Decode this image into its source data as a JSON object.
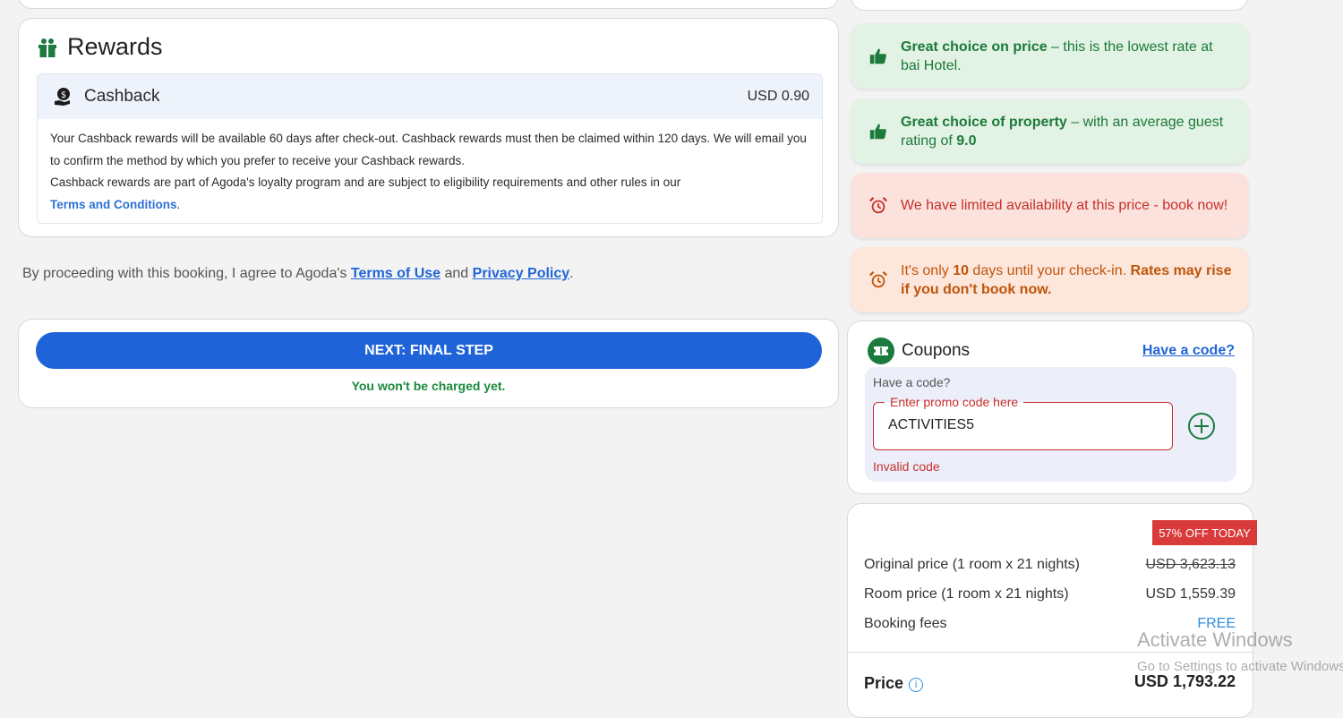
{
  "rewards": {
    "title": "Rewards",
    "cashback_label": "Cashback",
    "cashback_amount": "USD 0.90",
    "text_1": "Your Cashback rewards will be available 60 days after check-out. Cashback rewards must then be claimed within 120 days. We will email you to confirm the method by which you prefer to receive your Cashback rewards.",
    "text_2": "Cashback rewards are part of Agoda's loyalty program and are subject to eligibility requirements and other rules in our",
    "terms_link": "Terms and Conditions",
    "terms_suffix": "."
  },
  "agreement": {
    "prefix": "By proceeding with this booking, I agree to Agoda's",
    "terms_link": "Terms of Use",
    "and": "and",
    "privacy_link": "Privacy Policy",
    "suffix": "."
  },
  "next": {
    "button_label": "NEXT: FINAL STEP",
    "note": "You won't be charged yet."
  },
  "messages": {
    "price_bold": "Great choice on price",
    "price_rest": " – this is the lowest rate at bai Hotel.",
    "property_bold": "Great choice of property",
    "property_rest": " – with an average guest rating of ",
    "property_rating": "9.0",
    "limited": "We have limited availability at this price - book now!",
    "days_prefix": "It's only ",
    "days_count": "10",
    "days_mid": " days until your check-in. ",
    "days_bold": "Rates may rise if you don't book now."
  },
  "coupons": {
    "title": "Coupons",
    "have_code_link": "Have a code?",
    "have_code_label": "Have a code?",
    "promo_legend": "Enter promo code here",
    "promo_value": "ACTIVITIES5",
    "error": "Invalid code"
  },
  "pricing": {
    "badge": "57% OFF TODAY",
    "original_label": "Original price (1 room x 21 nights)",
    "original_value": "USD 3,623.13",
    "room_label": "Room price (1 room x 21 nights)",
    "room_value": "USD 1,559.39",
    "fees_label": "Booking fees",
    "fees_value": "FREE",
    "total_label": "Price",
    "total_value": "USD 1,793.22"
  },
  "watermark": {
    "line1": "Activate Windows",
    "line2": "Go to Settings to activate Windows."
  },
  "colors": {
    "primary_button": "#1f63d9",
    "success_green": "#1c7a3a",
    "error_red": "#c9302c",
    "warning_orange": "#c0560a",
    "badge_red": "#d93a3a"
  },
  "icons": [
    "gift-icon",
    "cashback-icon",
    "thumbs-up-icon",
    "alarm-clock-icon",
    "coupon-icon",
    "add-circle-icon",
    "info-icon"
  ]
}
